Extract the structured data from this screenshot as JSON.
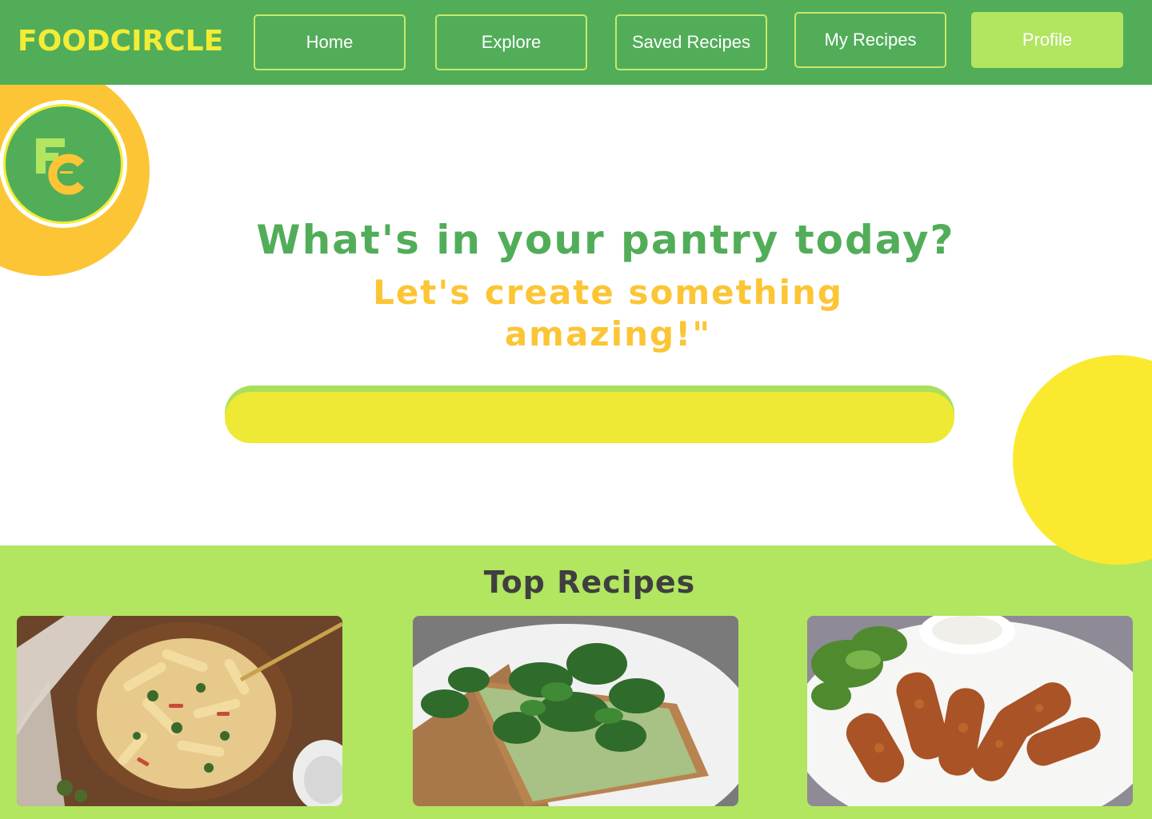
{
  "header": {
    "brand": "FOODCIRCLE",
    "nav": [
      {
        "label": "Home"
      },
      {
        "label": "Explore"
      },
      {
        "label": "Saved Recipes"
      },
      {
        "label": "My Recipes"
      },
      {
        "label": "Profile"
      }
    ]
  },
  "logo": {
    "monogram": "FC"
  },
  "hero": {
    "title": "What's in your pantry today?",
    "subtitle": "Let's create something amazing!\""
  },
  "search": {
    "value": "",
    "placeholder": ""
  },
  "top_recipes": {
    "title": "Top Recipes",
    "cards": [
      {
        "image": "creamy-penne-pasta-bowl"
      },
      {
        "image": "spinach-avocado-toast"
      },
      {
        "image": "crispy-chicken-tenders"
      }
    ]
  },
  "colors": {
    "header_green": "#52ad59",
    "brand_yellow": "#f3ec35",
    "light_green": "#b2e560",
    "accent_orange": "#fcc535",
    "circle_yellow": "#fbe930"
  }
}
